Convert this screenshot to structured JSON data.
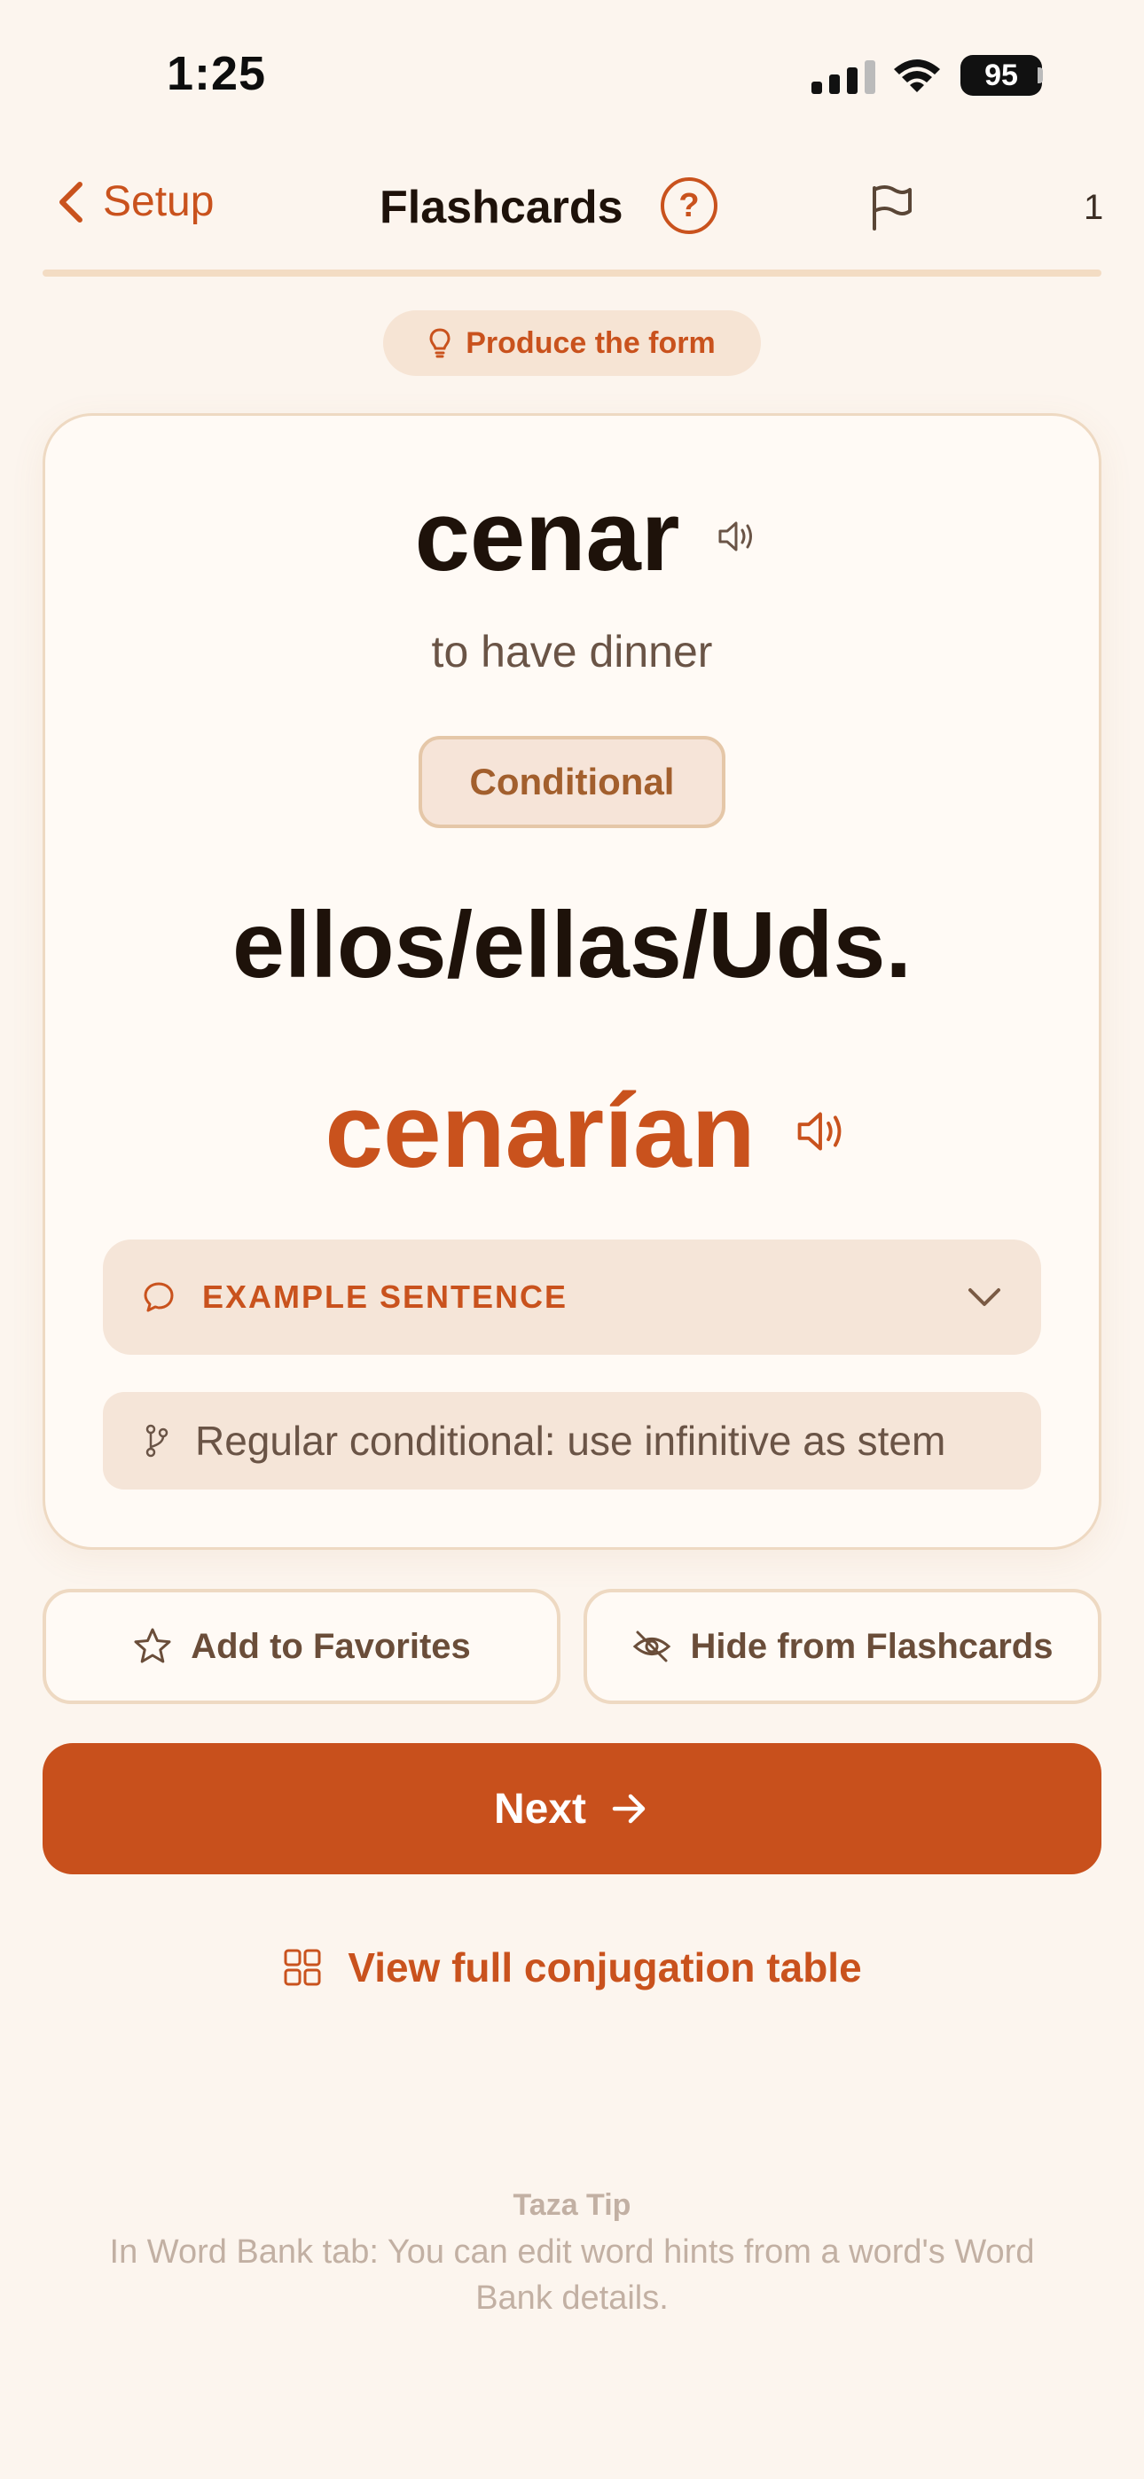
{
  "status_bar": {
    "time": "1:25",
    "battery": "95"
  },
  "nav": {
    "back_label": "Setup",
    "title": "Flashcards",
    "help_label": "?",
    "counter": "1",
    "progress": 0.0
  },
  "mode_pill": {
    "label": "Produce the form",
    "icon": "lightbulb-icon"
  },
  "card": {
    "verb": "cenar",
    "translation": "to have dinner",
    "tense": "Conditional",
    "pronoun": "ellos/ellas/Uds.",
    "answer": "cenarían",
    "example_label": "EXAMPLE SENTENCE",
    "rule": "Regular conditional: use infinitive as stem"
  },
  "actions": {
    "favorite_label": "Add to Favorites",
    "hide_label": "Hide from Flashcards",
    "next_label": "Next",
    "table_link": "View full conjugation table"
  },
  "tip": {
    "title": "Taza Tip",
    "text": "In Word Bank tab: You can edit word hints from a word's Word Bank details."
  },
  "colors": {
    "accent": "#c8501c",
    "background": "#fcf5ee",
    "card": "#fffaf5",
    "muted_text": "#c2b0a3"
  }
}
